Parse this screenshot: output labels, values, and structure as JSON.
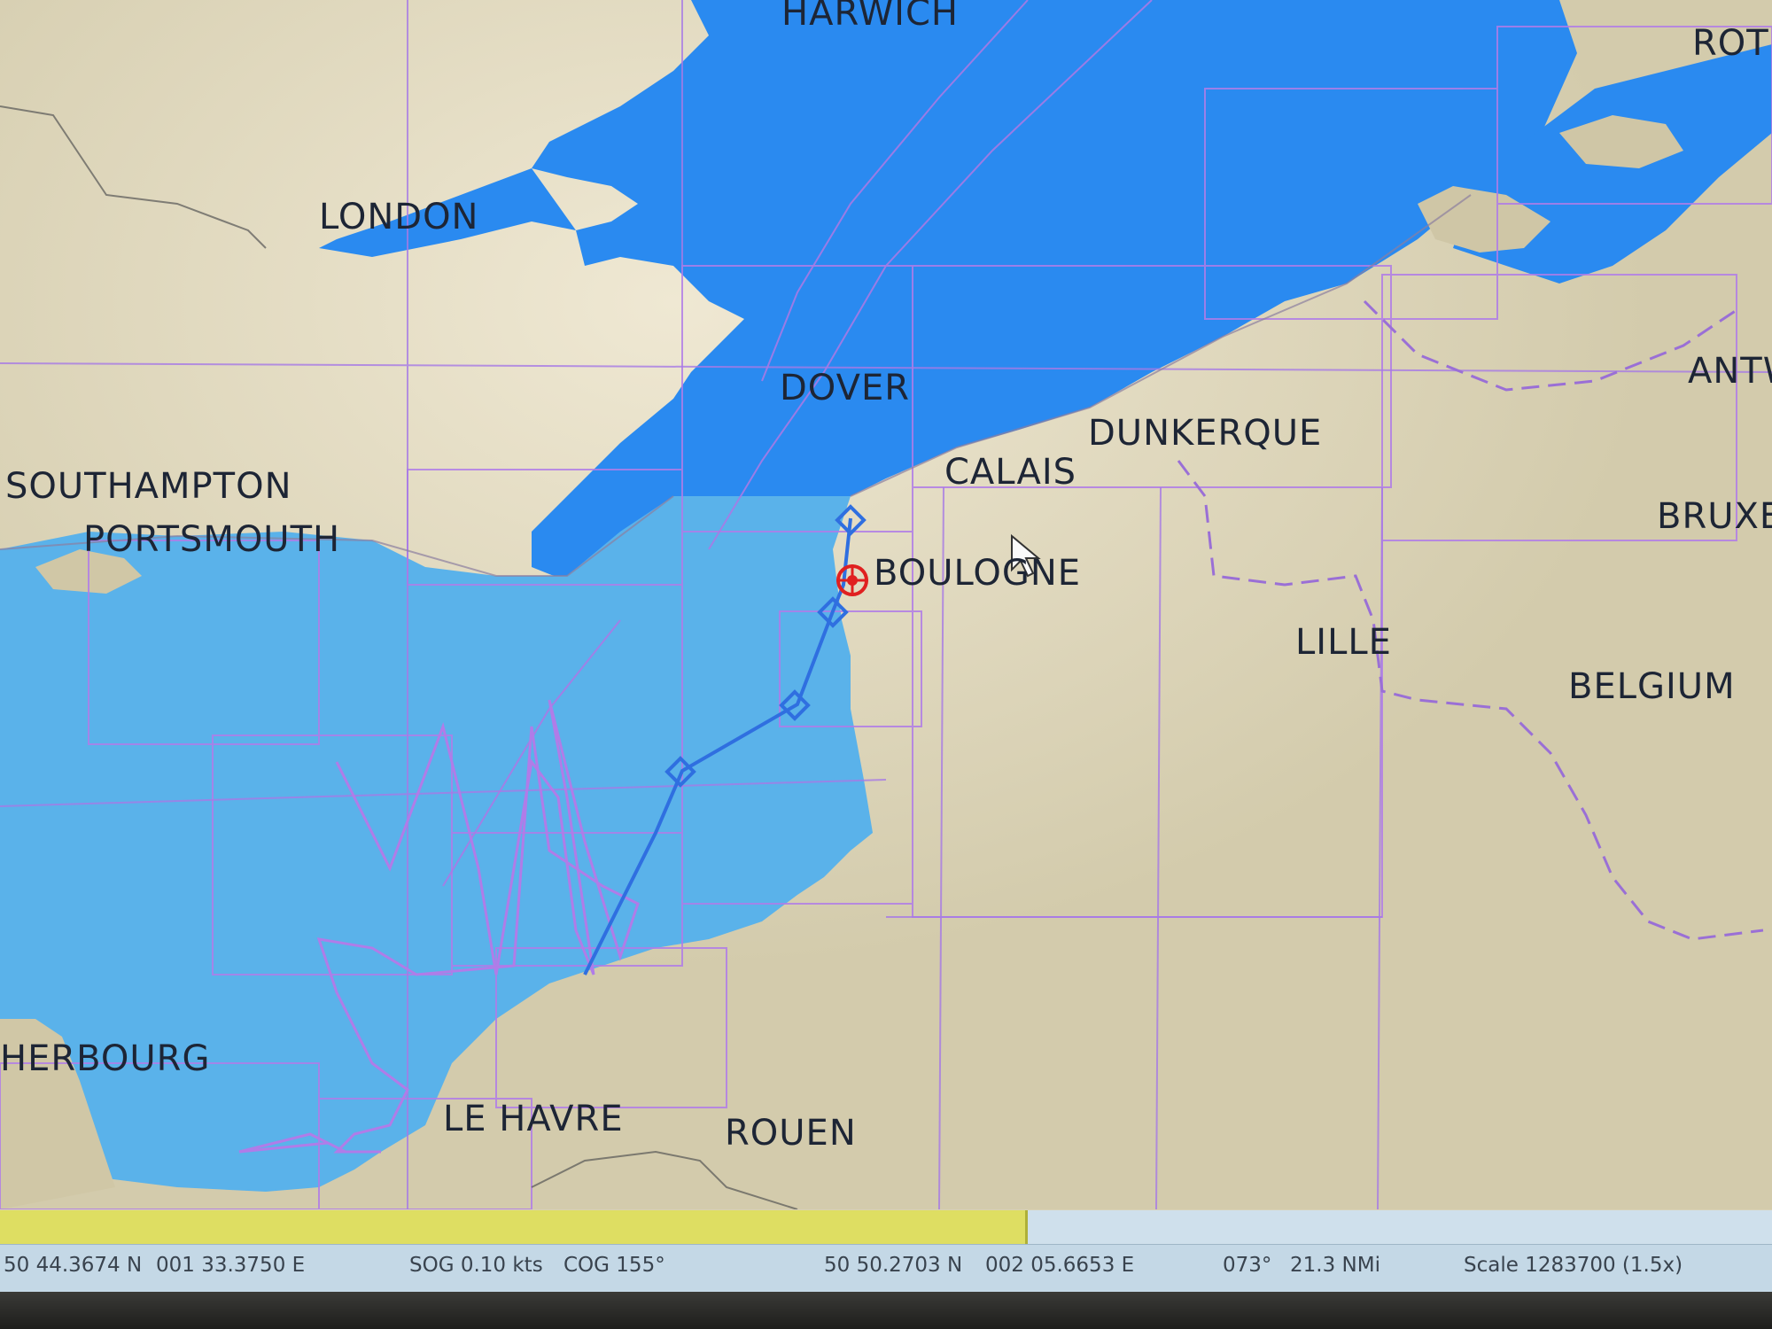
{
  "places": {
    "harwich": "HARWICH",
    "rot": "ROT",
    "london": "LONDON",
    "dover": "DOVER",
    "antw": "ANTW",
    "dunkerque": "DUNKERQUE",
    "calais": "CALAIS",
    "southampton": "SOUTHAMPTON",
    "portsmouth": "PORTSMOUTH",
    "bruxe": "BRUXE",
    "boulogne": "BOULOGNE",
    "lille": "LILLE",
    "belgium": "BELGIUM",
    "cherbourg": "HERBOURG",
    "le_havre": "LE HAVRE",
    "rouen": "ROUEN"
  },
  "progress": {
    "fraction": 0.58
  },
  "status": {
    "cursor_lat": "50 44.3674 N",
    "cursor_lon": "001 33.3750 E",
    "sog": "SOG 0.10 kts",
    "cog": "COG 155°",
    "boat_lat": "50 50.2703 N",
    "boat_lon": "002 05.6653 E",
    "bearing": "073°",
    "distance": "21.3 NMi",
    "scale": "Scale 1283700 (1.5x)"
  },
  "colors": {
    "sea_deep": "#2a8af0",
    "sea_light": "#5ab2ea",
    "land": "#d6ceb0",
    "chart_outline": "#b07ce8",
    "route": "#2f6fe0",
    "boat": "#e02020"
  },
  "icons": {
    "boat": "boat-position-icon",
    "cursor": "arrow-cursor-icon",
    "waypoint": "waypoint-diamond-icon"
  }
}
